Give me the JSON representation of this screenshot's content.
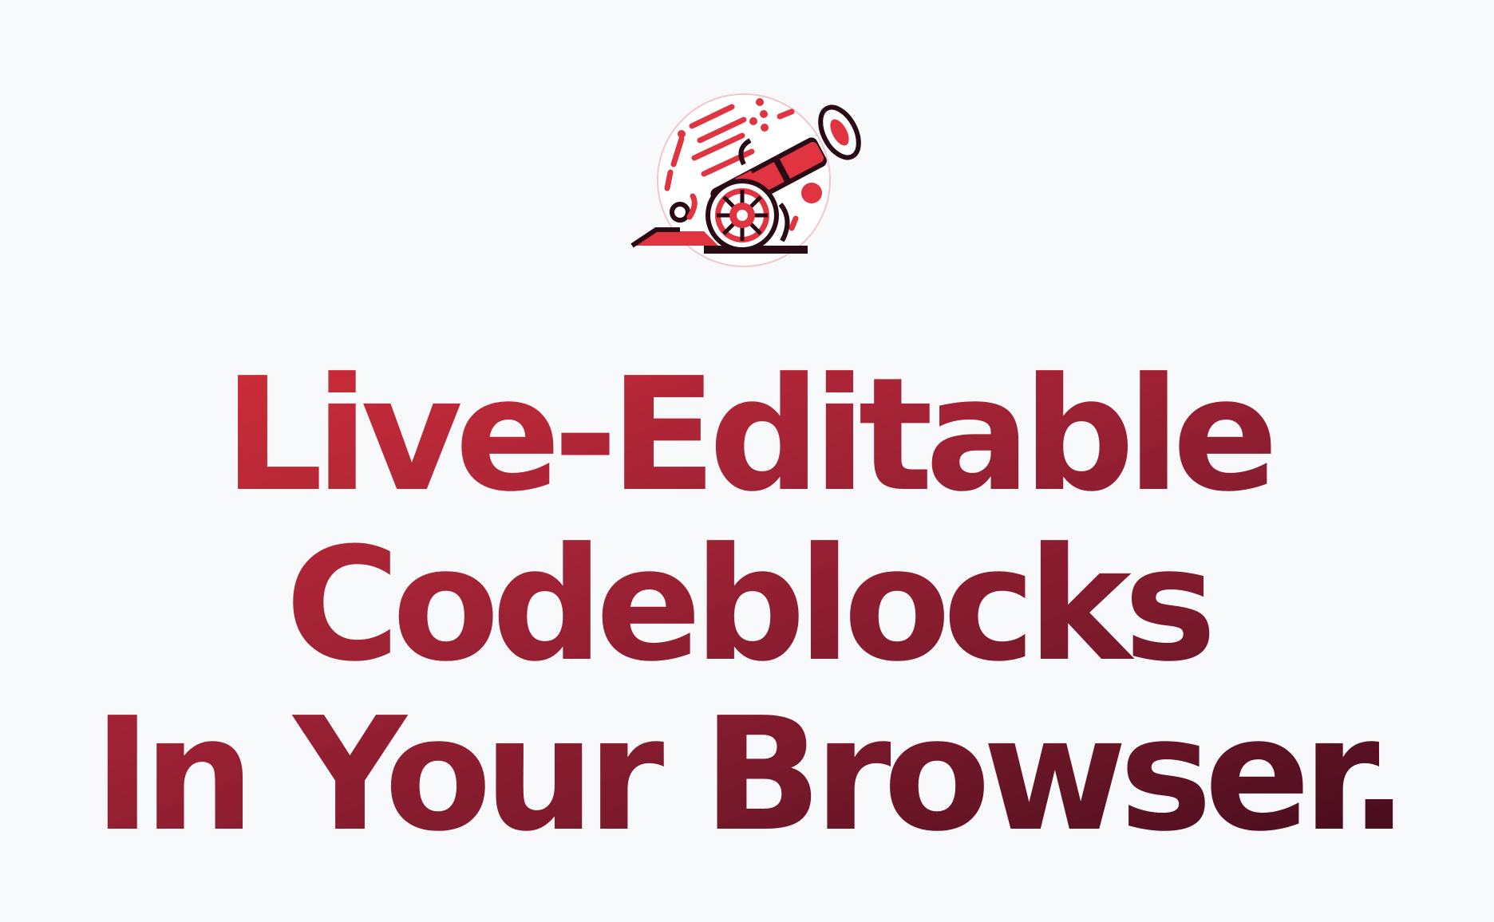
{
  "brand": {
    "logo_icon": "cannon-logo-icon",
    "colors": {
      "accent_red": "#e03440",
      "dark_maroon": "#2a0a14",
      "background": "#f8f9fb"
    }
  },
  "hero": {
    "headline_lines": [
      "Live-Editable",
      "Codeblocks",
      "In Your Browser."
    ]
  }
}
